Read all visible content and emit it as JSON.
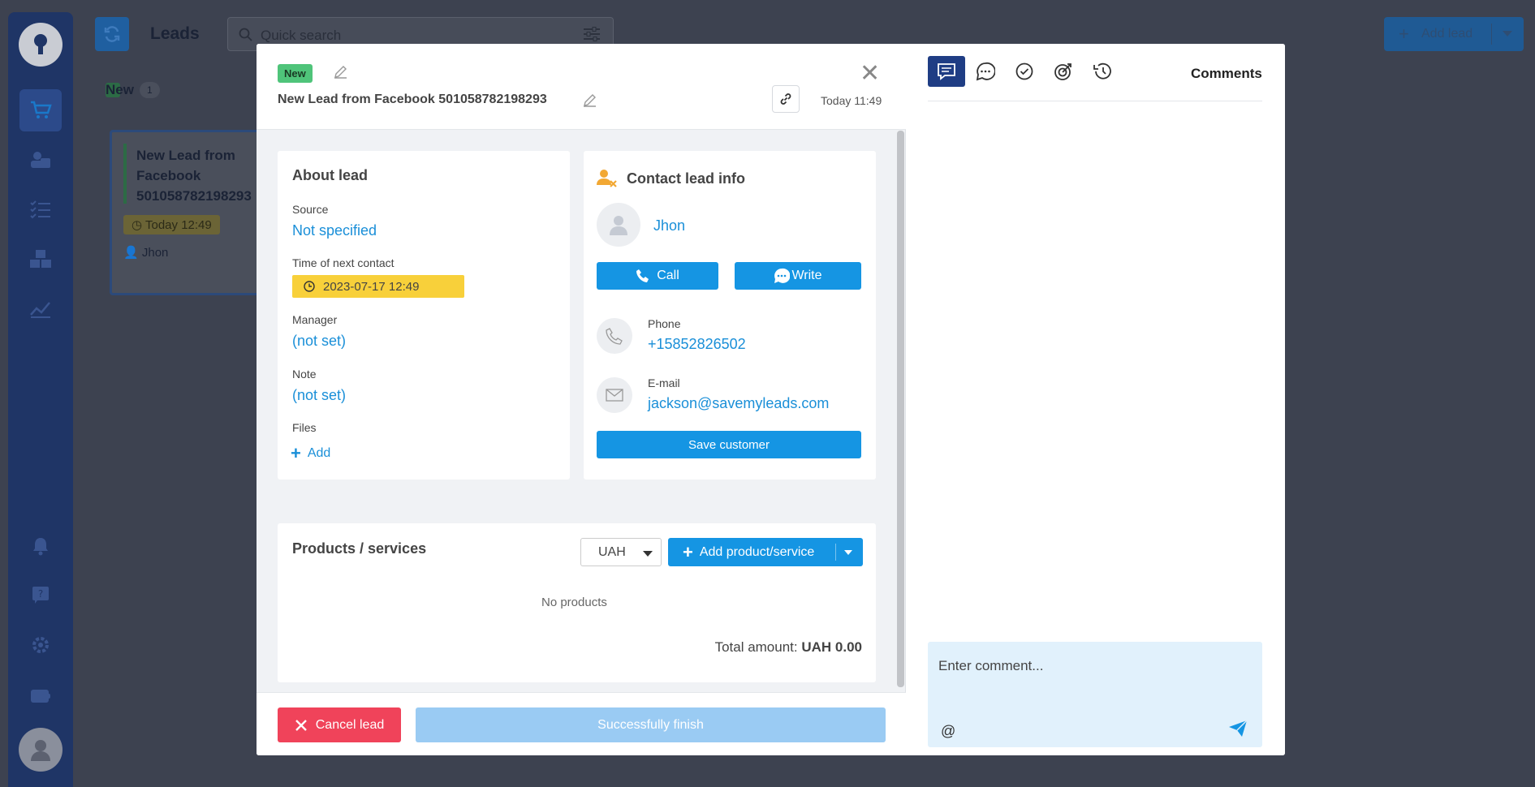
{
  "background": {
    "page_title": "Leads",
    "search_placeholder": "Quick search",
    "add_lead_label": "Add lead",
    "column": {
      "name": "New",
      "count": "1"
    },
    "card": {
      "title": "New Lead from Facebook 501058782198293",
      "due": "Today 12:49",
      "manager": "Jhon"
    },
    "sidebar_icons": [
      "key-icon",
      "cart-icon",
      "contacts-icon",
      "tasks-icon",
      "boxes-icon",
      "analytics-icon",
      "bell-icon",
      "help-icon",
      "gear-icon",
      "wallet-icon",
      "user-avatar"
    ]
  },
  "modal": {
    "status_badge": "New",
    "title": "New Lead from Facebook 501058782198293",
    "created": "Today 11:49",
    "about": {
      "heading": "About lead",
      "source_label": "Source",
      "source_value": "Not specified",
      "next_contact_label": "Time of next contact",
      "next_contact_value": "2023-07-17 12:49",
      "manager_label": "Manager",
      "manager_value": "(not set)",
      "note_label": "Note",
      "note_value": "(not set)",
      "files_label": "Files",
      "files_add": "Add"
    },
    "contact": {
      "heading": "Contact lead info",
      "name": "Jhon",
      "call_label": "Call",
      "write_label": "Write",
      "phone_label": "Phone",
      "phone_value": "+15852826502",
      "email_label": "E-mail",
      "email_value": "jackson@savemyleads.com",
      "save_label": "Save customer"
    },
    "products": {
      "heading": "Products / services",
      "currency": "UAH",
      "add_label": "Add product/service",
      "empty_text": "No products",
      "total_label": "Total amount:",
      "total_value": "UAH 0.00"
    },
    "footer": {
      "cancel_label": "Cancel lead",
      "finish_label": "Successfully finish"
    },
    "comments": {
      "title": "Comments",
      "placeholder": "Enter comment...",
      "mention_symbol": "@"
    }
  },
  "colors": {
    "accent": "#1595e3",
    "danger": "#f0435a",
    "badge_green": "#4fc47a",
    "date_yellow": "#f8d03a",
    "active_tab": "#1f3d84"
  }
}
